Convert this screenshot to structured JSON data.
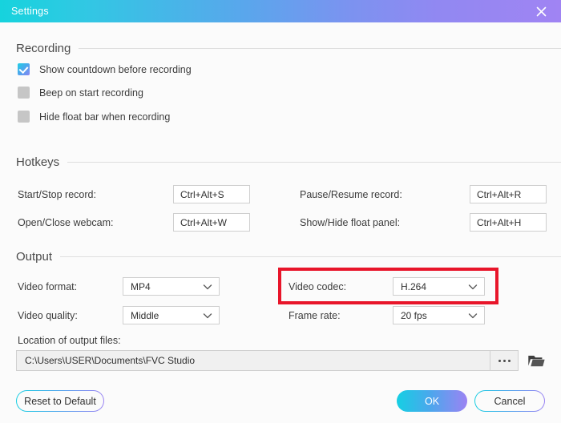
{
  "window": {
    "title": "Settings",
    "close_icon": "close-icon"
  },
  "sections": {
    "recording": {
      "title": "Recording",
      "options": [
        {
          "label": "Show countdown before recording",
          "checked": true
        },
        {
          "label": "Beep on start recording",
          "checked": false
        },
        {
          "label": "Hide float bar when recording",
          "checked": false
        }
      ]
    },
    "hotkeys": {
      "title": "Hotkeys",
      "fields": [
        {
          "label": "Start/Stop record:",
          "value": "Ctrl+Alt+S"
        },
        {
          "label": "Pause/Resume record:",
          "value": "Ctrl+Alt+R"
        },
        {
          "label": "Open/Close webcam:",
          "value": "Ctrl+Alt+W"
        },
        {
          "label": "Show/Hide float panel:",
          "value": "Ctrl+Alt+H"
        }
      ]
    },
    "output": {
      "title": "Output",
      "video_format": {
        "label": "Video format:",
        "value": "MP4"
      },
      "video_codec": {
        "label": "Video codec:",
        "value": "H.264"
      },
      "video_quality": {
        "label": "Video quality:",
        "value": "Middle"
      },
      "frame_rate": {
        "label": "Frame rate:",
        "value": "20 fps"
      },
      "location": {
        "label": "Location of output files:",
        "value": "C:\\Users\\USER\\Documents\\FVC Studio",
        "browse_icon": "ellipsis-icon",
        "folder_icon": "folder-open-icon"
      }
    }
  },
  "footer": {
    "reset_label": "Reset to Default",
    "ok_label": "OK",
    "cancel_label": "Cancel"
  },
  "annotation": {
    "highlight_color": "#e8152a",
    "target": "Video codec"
  },
  "theme": {
    "accent_start": "#16d3dd",
    "accent_end": "#a084f3",
    "background": "#fbfbfb",
    "text": "#3c3c3c"
  }
}
